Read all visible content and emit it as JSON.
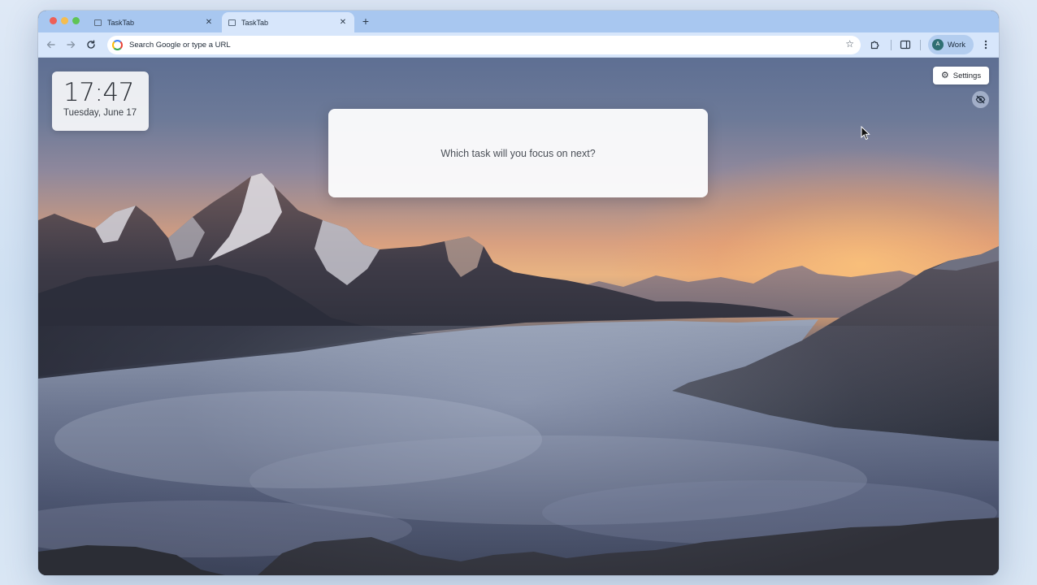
{
  "browser": {
    "tabs": [
      {
        "title": "TaskTab",
        "active": false
      },
      {
        "title": "TaskTab",
        "active": true
      }
    ],
    "new_tab_symbol": "+",
    "close_symbol": "✕",
    "omnibox": {
      "placeholder": "Search Google or type a URL",
      "icon": "google-icon"
    },
    "profile": {
      "initial": "A",
      "label": "Work",
      "avatar_color": "#2f6f73"
    },
    "accent": "#a8c7f0"
  },
  "page": {
    "clock": {
      "time": "17:47",
      "date": "Tuesday, June 17"
    },
    "task_prompt": "Which task will you focus on next?",
    "settings_label": "Settings",
    "background": "mountain sunrise above cloud sea"
  }
}
